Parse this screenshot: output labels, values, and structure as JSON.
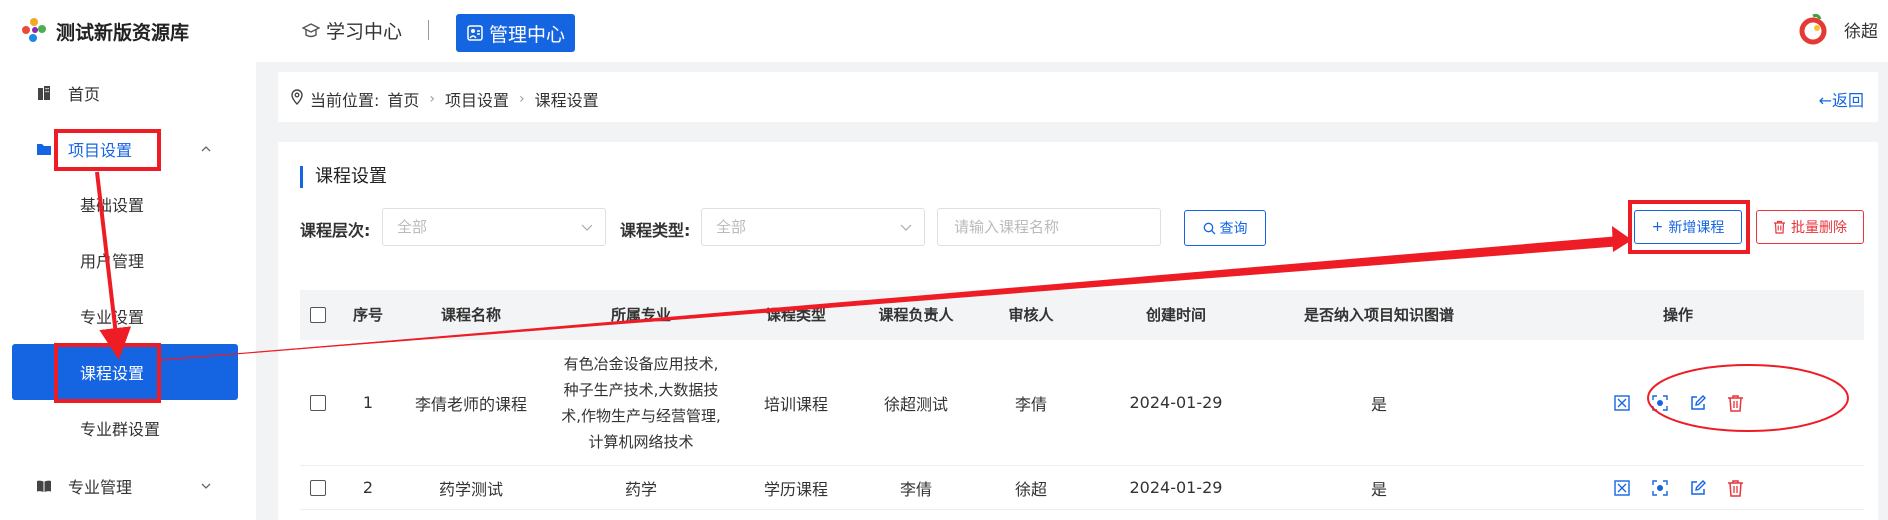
{
  "header": {
    "logo_text": "测试新版资源库",
    "nav_learn": "学习中心",
    "nav_admin": "管理中心",
    "user_name": "徐超"
  },
  "sidebar": {
    "home": "首页",
    "project_settings": "项目设置",
    "sub_items": [
      "基础设置",
      "用户管理",
      "专业设置",
      "课程设置",
      "专业群设置"
    ],
    "major_management": "专业管理"
  },
  "breadcrumb": {
    "prefix": "当前位置:",
    "items": [
      "首页",
      "项目设置",
      "课程设置"
    ],
    "back": "←返回"
  },
  "card": {
    "title": "课程设置",
    "filter_level_label": "课程层次:",
    "filter_level_value": "全部",
    "filter_type_label": "课程类型:",
    "filter_type_value": "全部",
    "search_placeholder": "请输入课程名称",
    "query_button": "查询",
    "add_button": "新增课程",
    "batch_delete_button": "批量删除"
  },
  "table": {
    "columns": [
      "序号",
      "课程名称",
      "所属专业",
      "课程类型",
      "课程负责人",
      "审核人",
      "创建时间",
      "是否纳入项目知识图谱",
      "操作"
    ],
    "rows": [
      {
        "index": "1",
        "name": "李倩老师的课程",
        "major": "有色冶金设备应用技术,种子生产技术,大数据技术,作物生产与经营管理,计算机网络技术",
        "type": "培训课程",
        "owner": "徐超测试",
        "reviewer": "李倩",
        "created": "2024-01-29",
        "in_graph": "是"
      },
      {
        "index": "2",
        "name": "药学测试",
        "major": "药学",
        "type": "学历课程",
        "owner": "李倩",
        "reviewer": "徐超",
        "created": "2024-01-29",
        "in_graph": "是"
      }
    ]
  },
  "colors": {
    "primary": "#1565e3",
    "danger": "#e8343d",
    "annotation": "#ee1c25"
  }
}
